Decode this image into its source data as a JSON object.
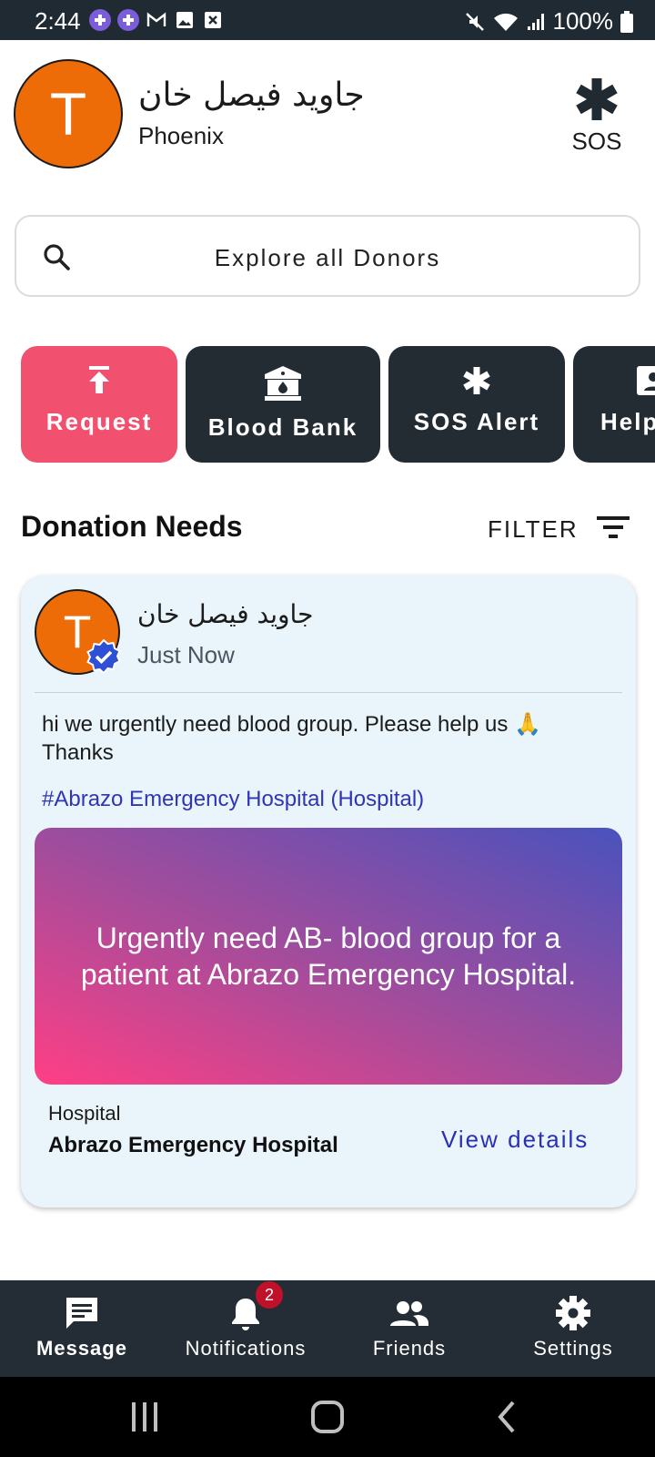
{
  "status_bar": {
    "time": "2:44",
    "battery": "100%",
    "icons": [
      "medical-app-icon",
      "medical-app-icon",
      "gmail-icon",
      "gallery-icon",
      "close-box-icon",
      "mute-icon",
      "wifi-icon",
      "signal-icon",
      "battery-icon"
    ]
  },
  "profile": {
    "avatar_letter": "T",
    "name": "جاوید فیصل خان",
    "city": "Phoenix",
    "avatar_color": "#EE6C07"
  },
  "sos": {
    "label": "SOS",
    "icon": "asterisk-icon"
  },
  "search": {
    "placeholder": "Explore all Donors",
    "icon": "search-icon"
  },
  "quick_actions": [
    {
      "label": "Request",
      "icon": "upload-icon",
      "color": "#F2506F"
    },
    {
      "label": "Blood Bank",
      "icon": "bank-icon",
      "color": "#232B33"
    },
    {
      "label": "SOS Alert",
      "icon": "asterisk-icon",
      "color": "#232B33"
    },
    {
      "label": "Help",
      "icon": "contact-card-icon",
      "color": "#232B33"
    }
  ],
  "donation_needs": {
    "title": "Donation Needs",
    "filter_label": "FILTER"
  },
  "post": {
    "avatar_letter": "T",
    "author": "جاوید فیصل خان",
    "time": "Just Now",
    "message": "hi we urgently need blood group. Please help us 🙏 Thanks",
    "tag": "#Abrazo Emergency Hospital (Hospital)",
    "banner_text": "Urgently need AB- blood group for a patient at Abrazo Emergency Hospital.",
    "hospital_label": "Hospital",
    "hospital_name": "Abrazo Emergency Hospital",
    "view_details": "View details"
  },
  "bottom_nav": {
    "items": [
      {
        "label": "Message",
        "icon": "message-icon",
        "active": true
      },
      {
        "label": "Notifications",
        "icon": "bell-icon",
        "badge": "2"
      },
      {
        "label": "Friends",
        "icon": "people-icon"
      },
      {
        "label": "Settings",
        "icon": "gear-icon"
      }
    ]
  },
  "colors": {
    "accent_pink": "#F2506F",
    "dark": "#232B33",
    "link_blue": "#2A2FB3",
    "card_bg": "#E9F5FA"
  }
}
